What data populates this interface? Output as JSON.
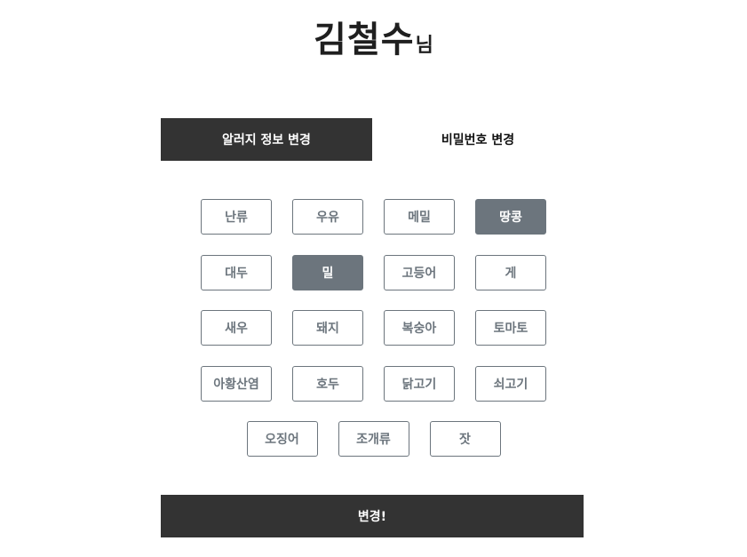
{
  "header": {
    "name": "김철수",
    "suffix": "님"
  },
  "tabs": [
    {
      "label": "알러지 정보 변경",
      "active": true
    },
    {
      "label": "비밀번호 변경",
      "active": false
    }
  ],
  "allergies": {
    "rows": [
      [
        {
          "label": "난류",
          "selected": false
        },
        {
          "label": "우유",
          "selected": false
        },
        {
          "label": "메밀",
          "selected": false
        },
        {
          "label": "땅콩",
          "selected": true
        }
      ],
      [
        {
          "label": "대두",
          "selected": false
        },
        {
          "label": "밀",
          "selected": true
        },
        {
          "label": "고등어",
          "selected": false
        },
        {
          "label": "게",
          "selected": false
        }
      ],
      [
        {
          "label": "새우",
          "selected": false
        },
        {
          "label": "돼지",
          "selected": false
        },
        {
          "label": "복숭아",
          "selected": false
        },
        {
          "label": "토마토",
          "selected": false
        }
      ],
      [
        {
          "label": "아황산염",
          "selected": false
        },
        {
          "label": "호두",
          "selected": false
        },
        {
          "label": "닭고기",
          "selected": false
        },
        {
          "label": "쇠고기",
          "selected": false
        }
      ],
      [
        {
          "label": "오징어",
          "selected": false
        },
        {
          "label": "조개류",
          "selected": false
        },
        {
          "label": "잣",
          "selected": false
        }
      ]
    ]
  },
  "submit": {
    "label": "변경!"
  },
  "colors": {
    "dark": "#333333",
    "chip_border": "#6c757d",
    "chip_selected_bg": "#6c757d"
  }
}
